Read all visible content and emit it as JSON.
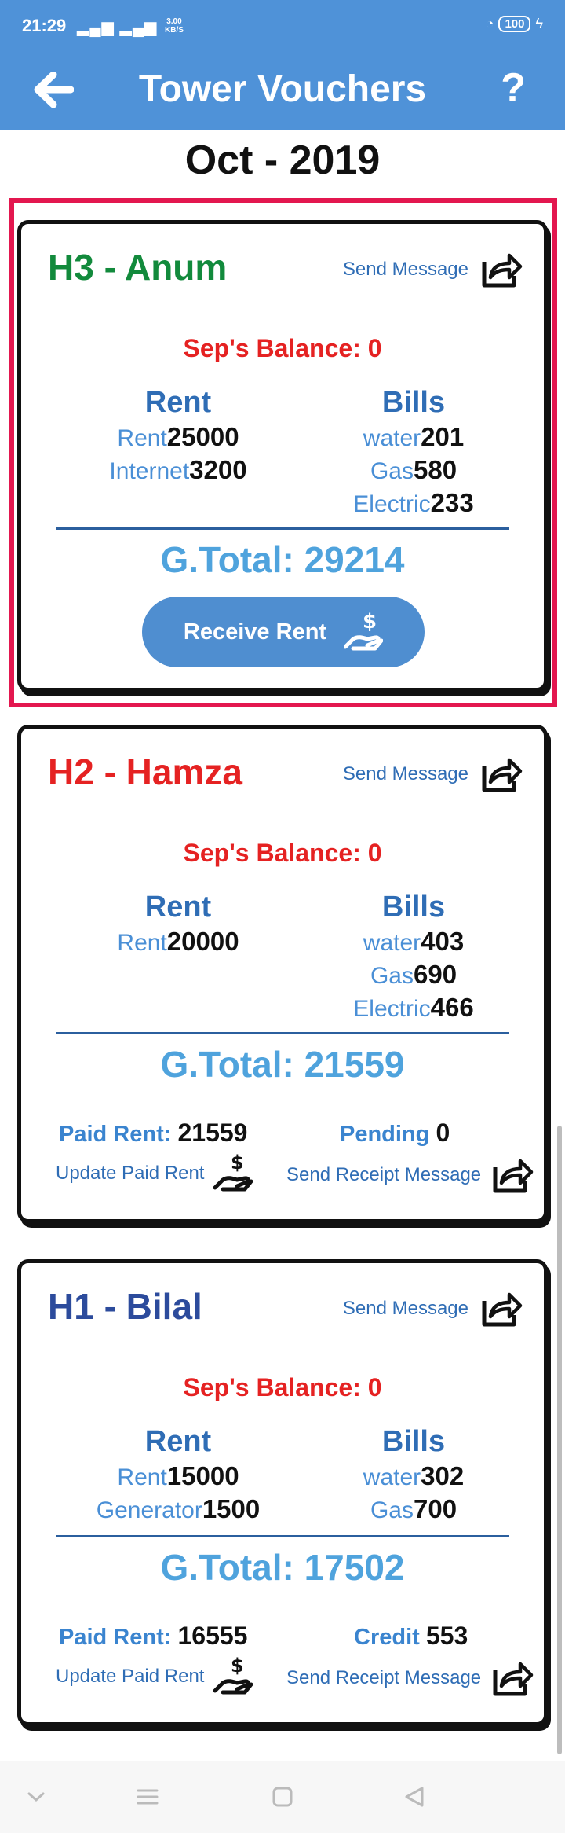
{
  "status_bar": {
    "time": "21:29",
    "signal": "▂▄▆ ▂▄▆",
    "speed_top": "3.00",
    "speed_bottom": "KB/S",
    "battery": "100"
  },
  "header": {
    "title": "Tower Vouchers",
    "help_label": "?"
  },
  "month": "Oct - 2019",
  "cards": [
    {
      "name": "H3 - Anum",
      "name_color": "#128a3c",
      "send_message": "Send Message",
      "balance": "Sep's Balance: 0",
      "rent_head": "Rent",
      "bills_head": "Bills",
      "rent_items": [
        {
          "label": "Rent",
          "value": "25000"
        },
        {
          "label": "Internet",
          "value": "3200"
        }
      ],
      "bill_items": [
        {
          "label": "water",
          "value": "201"
        },
        {
          "label": "Gas",
          "value": "580"
        },
        {
          "label": "Electric",
          "value": "233"
        }
      ],
      "gtotal": "G.Total: 29214",
      "receive_label": "Receive Rent"
    },
    {
      "name": "H2 - Hamza",
      "name_color": "#e52222",
      "send_message": "Send Message",
      "balance": "Sep's Balance: 0",
      "rent_head": "Rent",
      "bills_head": "Bills",
      "rent_items": [
        {
          "label": "Rent",
          "value": "20000"
        }
      ],
      "bill_items": [
        {
          "label": "water",
          "value": "403"
        },
        {
          "label": "Gas",
          "value": "690"
        },
        {
          "label": "Electric",
          "value": "466"
        }
      ],
      "gtotal": "G.Total: 21559",
      "paid_label": "Paid Rent:",
      "paid_value": "21559",
      "status_label": "Pending",
      "status_value": "0",
      "update_label": "Update Paid Rent",
      "receipt_label": "Send Receipt Message"
    },
    {
      "name": "H1 - Bilal",
      "name_color": "#2c4b9c",
      "send_message": "Send Message",
      "balance": "Sep's Balance: 0",
      "rent_head": "Rent",
      "bills_head": "Bills",
      "rent_items": [
        {
          "label": "Rent",
          "value": "15000"
        },
        {
          "label": "Generator",
          "value": "1500"
        }
      ],
      "bill_items": [
        {
          "label": "water",
          "value": "302"
        },
        {
          "label": "Gas",
          "value": "700"
        }
      ],
      "gtotal": "G.Total: 17502",
      "paid_label": "Paid Rent:",
      "paid_value": "16555",
      "status_label": "Credit",
      "status_value": "553",
      "update_label": "Update Paid Rent",
      "receipt_label": "Send Receipt Message"
    }
  ],
  "icons": {
    "back": "arrow-left-icon",
    "share": "share-icon",
    "cash": "hand-dollar-icon",
    "nav": [
      "chevron-down-icon",
      "menu-icon",
      "home-square-icon",
      "back-triangle-icon"
    ]
  }
}
